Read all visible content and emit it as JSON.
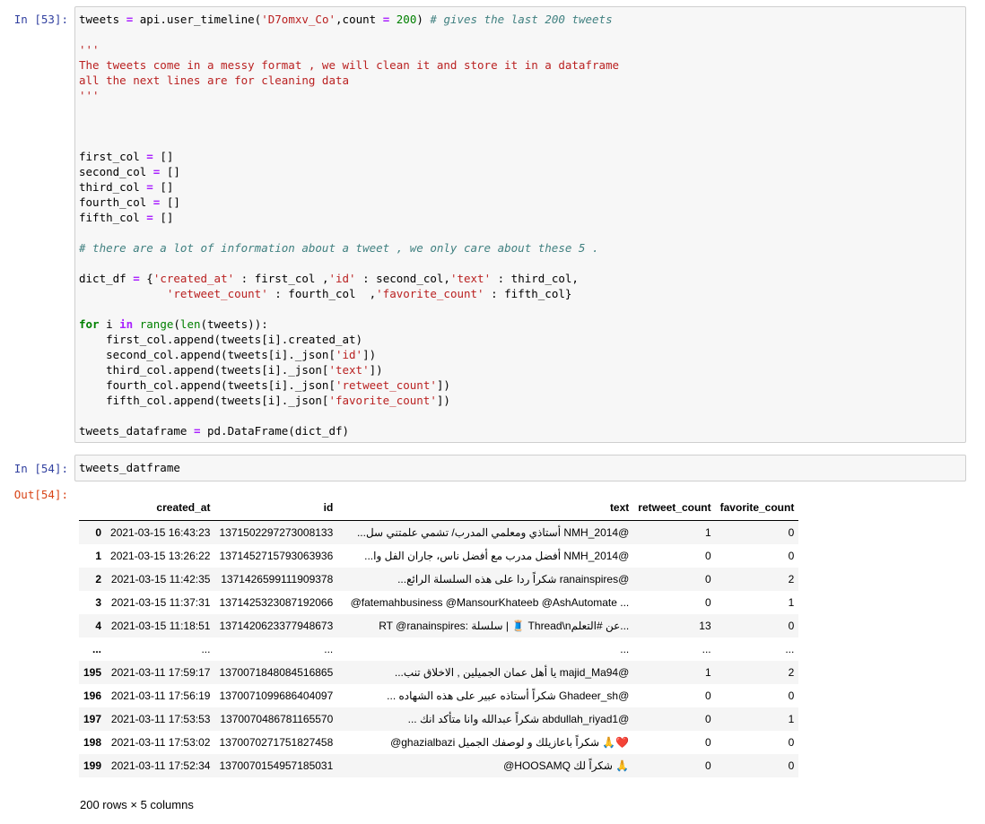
{
  "cells": [
    {
      "prompt": "In [53]:",
      "lines": [
        [
          [
            "var",
            "tweets "
          ],
          [
            "op",
            "="
          ],
          [
            "var",
            " api.user_timeline("
          ],
          [
            "str",
            "'D7omxv_Co'"
          ],
          [
            "var",
            ",count "
          ],
          [
            "op",
            "="
          ],
          [
            "var",
            " "
          ],
          [
            "num",
            "200"
          ],
          [
            "var",
            ") "
          ],
          [
            "cm",
            "# gives the last 200 tweets"
          ]
        ],
        [],
        [
          [
            "str",
            "'''"
          ]
        ],
        [
          [
            "str",
            "The tweets come in a messy format , we will clean it and store it in a dataframe"
          ]
        ],
        [
          [
            "str",
            "all the next lines are for cleaning data"
          ]
        ],
        [
          [
            "str",
            "'''"
          ]
        ],
        [],
        [],
        [],
        [
          [
            "var",
            "first_col "
          ],
          [
            "op",
            "="
          ],
          [
            "var",
            " []"
          ]
        ],
        [
          [
            "var",
            "second_col "
          ],
          [
            "op",
            "="
          ],
          [
            "var",
            " []"
          ]
        ],
        [
          [
            "var",
            "third_col "
          ],
          [
            "op",
            "="
          ],
          [
            "var",
            " []"
          ]
        ],
        [
          [
            "var",
            "fourth_col "
          ],
          [
            "op",
            "="
          ],
          [
            "var",
            " []"
          ]
        ],
        [
          [
            "var",
            "fifth_col "
          ],
          [
            "op",
            "="
          ],
          [
            "var",
            " []"
          ]
        ],
        [],
        [
          [
            "cm",
            "# there are a lot of information about a tweet , we only care about these 5 ."
          ]
        ],
        [],
        [
          [
            "var",
            "dict_df "
          ],
          [
            "op",
            "="
          ],
          [
            "var",
            " {"
          ],
          [
            "str",
            "'created_at'"
          ],
          [
            "var",
            " : first_col ,"
          ],
          [
            "str",
            "'id'"
          ],
          [
            "var",
            " : second_col,"
          ],
          [
            "str",
            "'text'"
          ],
          [
            "var",
            " : third_col,"
          ]
        ],
        [
          [
            "var",
            "             "
          ],
          [
            "str",
            "'retweet_count'"
          ],
          [
            "var",
            " : fourth_col  ,"
          ],
          [
            "str",
            "'favorite_count'"
          ],
          [
            "var",
            " : fifth_col}"
          ]
        ],
        [],
        [
          [
            "kw",
            "for"
          ],
          [
            "var",
            " i "
          ],
          [
            "op",
            "in"
          ],
          [
            "var",
            " "
          ],
          [
            "bi",
            "range"
          ],
          [
            "var",
            "("
          ],
          [
            "bi",
            "len"
          ],
          [
            "var",
            "(tweets)):"
          ]
        ],
        [
          [
            "var",
            "    first_col.append(tweets[i].created_at)"
          ]
        ],
        [
          [
            "var",
            "    second_col.append(tweets[i]._json["
          ],
          [
            "str",
            "'id'"
          ],
          [
            "var",
            "])"
          ]
        ],
        [
          [
            "var",
            "    third_col.append(tweets[i]._json["
          ],
          [
            "str",
            "'text'"
          ],
          [
            "var",
            "])"
          ]
        ],
        [
          [
            "var",
            "    fourth_col.append(tweets[i]._json["
          ],
          [
            "str",
            "'retweet_count'"
          ],
          [
            "var",
            "])"
          ]
        ],
        [
          [
            "var",
            "    fifth_col.append(tweets[i]._json["
          ],
          [
            "str",
            "'favorite_count'"
          ],
          [
            "var",
            "])"
          ]
        ],
        [],
        [
          [
            "var",
            "tweets_dataframe "
          ],
          [
            "op",
            "="
          ],
          [
            "var",
            " pd.DataFrame(dict_df)"
          ]
        ]
      ]
    },
    {
      "prompt": "In [54]:",
      "lines": [
        [
          [
            "var",
            "tweets_datframe"
          ]
        ]
      ]
    }
  ],
  "output": {
    "prompt": "Out[54]:",
    "columns": [
      "",
      "created_at",
      "id",
      "text",
      "retweet_count",
      "favorite_count"
    ],
    "rows": [
      [
        "0",
        "2021-03-15 16:43:23",
        "1371502297273008133",
        "...أستاذي ومعلمي المدرب/ تشمي علمتني سل NMH_2014@",
        "1",
        "0"
      ],
      [
        "1",
        "2021-03-15 13:26:22",
        "1371452715793063936",
        "...أفضل مدرب مع أفضل ناس، جاران الفل وا NMH_2014@",
        "0",
        "0"
      ],
      [
        "2",
        "2021-03-15 11:42:35",
        "1371426599111909378",
        "...شكراً ردا على هذه السلسلة الرائع ranainspires@",
        "0",
        "2"
      ],
      [
        "3",
        "2021-03-15 11:37:31",
        "1371425323087192066",
        "@fatemahbusiness @MansourKhateeb @AshAutomate ...",
        "0",
        "1"
      ],
      [
        "4",
        "2021-03-15 11:18:51",
        "1371420623377948673",
        "RT @ranainspires: سلسلة | 🧵 Thread\\nعن #التعلم...",
        "13",
        "0"
      ],
      [
        "...",
        "...",
        "...",
        "...",
        "...",
        "..."
      ],
      [
        "195",
        "2021-03-11 17:59:17",
        "1370071848084516865",
        "...يا أهل عمان الجميلين , الاخلاق تنب majid_Ma94@",
        "1",
        "2"
      ],
      [
        "196",
        "2021-03-11 17:56:19",
        "1370071099686404097",
        "... شكراً أستاذه عبير على هذه الشهاده Ghadeer_sh@",
        "0",
        "0"
      ],
      [
        "197",
        "2021-03-11 17:53:53",
        "1370070486781165570",
        "... شكراً عبدالله وانا متأكد انك abdullah_riyad1@",
        "0",
        "1"
      ],
      [
        "198",
        "2021-03-11 17:53:02",
        "1370070271751827458",
        "@ghazialbazi شكراً باعازيلك و لوصفك الجميل 🙏❤️",
        "0",
        "0"
      ],
      [
        "199",
        "2021-03-11 17:52:34",
        "1370070154957185031",
        "@HOOSAMQ شكراً لك 🙏",
        "0",
        "0"
      ]
    ],
    "shape": "200 rows × 5 columns"
  }
}
